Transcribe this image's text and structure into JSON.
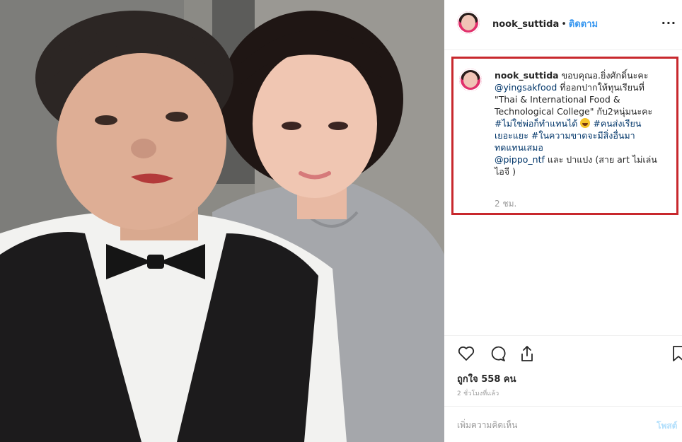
{
  "post_header": {
    "username": "nook_suttida",
    "separator": "•",
    "follow_label": "ติดตาม",
    "more_label": "..."
  },
  "caption": {
    "username": "nook_suttida",
    "text_1": "ขอบคุณอ.ยิ่งศักดิ์นะคะ",
    "mention_1": "@yingsakfood",
    "text_2": "ที่ออกปากให้ทุนเรียนที่",
    "text_3": "\"Thai & International Food &",
    "text_4": "Technological College\" กับ2หนุ่มนะคะ",
    "hashtag_1": "#ไม่ใช่พ่อก็ทำแทนได้",
    "hashtag_2": "#คนส่งเรียน",
    "hashtag_2b": "เยอะแยะ",
    "hashtag_3": "#ในความขาดจะมีสิ่งอื่นมา",
    "hashtag_3b": "ทดแทนเสมอ",
    "mention_2": "@pippo_ntf",
    "text_5": "และ ปาแปง (สาย art ไม่เล่น",
    "text_6": "ไอจี )",
    "time": "2 ชม."
  },
  "actions": {
    "likes": "ถูกใจ 558 คน",
    "post_age": "2 ชั่วโมงที่แล้ว"
  },
  "comment_box": {
    "placeholder": "เพิ่มความคิดเห็น",
    "post_label": "โพสต์"
  },
  "colors": {
    "highlight_border": "#c8282d",
    "link_blue": "#3897f0",
    "hashtag_blue": "#003569"
  },
  "icons": {
    "like": "heart-icon",
    "comment": "comment-icon",
    "share": "share-icon",
    "save": "bookmark-icon"
  }
}
